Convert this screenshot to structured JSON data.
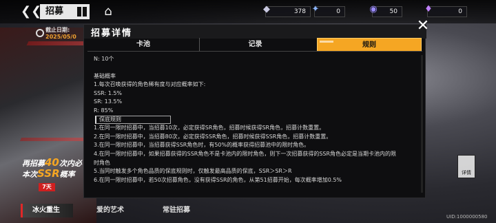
{
  "header": {
    "back_icon": "back-arrow-icon",
    "title": "招募",
    "home_icon": "home-icon"
  },
  "resources": [
    {
      "icon": "resource-crystal-icon",
      "value": "378"
    },
    {
      "icon": "resource-shard-icon",
      "value": "0"
    },
    {
      "icon": "resource-orb-icon",
      "value": "50"
    },
    {
      "icon": "resource-gem-icon",
      "value": "0"
    }
  ],
  "banner": {
    "end_date_label": "截止日期:",
    "end_date_value": "2025/05/0",
    "promo_line1_pre": "再招募",
    "promo_line1_num": "40",
    "promo_line1_post": "次内必",
    "promo_line2_pre": "本次",
    "promo_line2_hl": "SSR",
    "promo_line2_post": "概率",
    "days_left": "7天"
  },
  "pool_tabs": [
    {
      "label": "冰火重生"
    },
    {
      "label": "爱的艺术"
    },
    {
      "label": "常驻招募"
    }
  ],
  "modal": {
    "title": "招募详情",
    "close_icon": "close-icon",
    "tabs": [
      {
        "label": "卡池",
        "active": false
      },
      {
        "label": "记录",
        "active": false
      },
      {
        "label": "规则",
        "active": true
      }
    ],
    "lines": {
      "n": "N:  10个",
      "basic_title": "基础概率",
      "basic_desc": "1.每次召唤获得的角色稀有度与对应概率如下:",
      "ssr": "SSR:  1.5%",
      "sr": "SR:  13.5%",
      "r": "R:  85%",
      "guarantee_title": "保底规则",
      "rule1": "1.在同一限时招募中，当招募10次，必定获得SR角色，招募时候获得SR角色，招募计数重置。",
      "rule2": "2.在同一限时招募中，当招募80次，必定获得SSR角色，招募时候获得SSR角色，招募计数重置。",
      "rule3": "3.在同一限时招募中，当招募获得SSR角色时，有50%的概率获得招募池中的限时角色。",
      "rule4a": "4.在同一限时招募中，如果招募获得的SSR角色不是卡池内的限时角色，则下一次招募获得的SSR角色必定是当期卡池内的限",
      "rule4b": "时角色",
      "rule5": "5.当同时触发多个角色品质的保底规则时，仅触发最高品质的保底，SSR＞SR＞R",
      "rule6": "6.在同一限时招募中，若50次招募角色，没有获得SSR的角色，从第51招募开始，每次概率增加0.5%"
    }
  },
  "detail_button": {
    "label": "详情"
  },
  "uid": "UID:1000000580",
  "colors": {
    "accent": "#f5a623",
    "brand_red": "#d02020",
    "modal_bg": "#0e0e10"
  }
}
